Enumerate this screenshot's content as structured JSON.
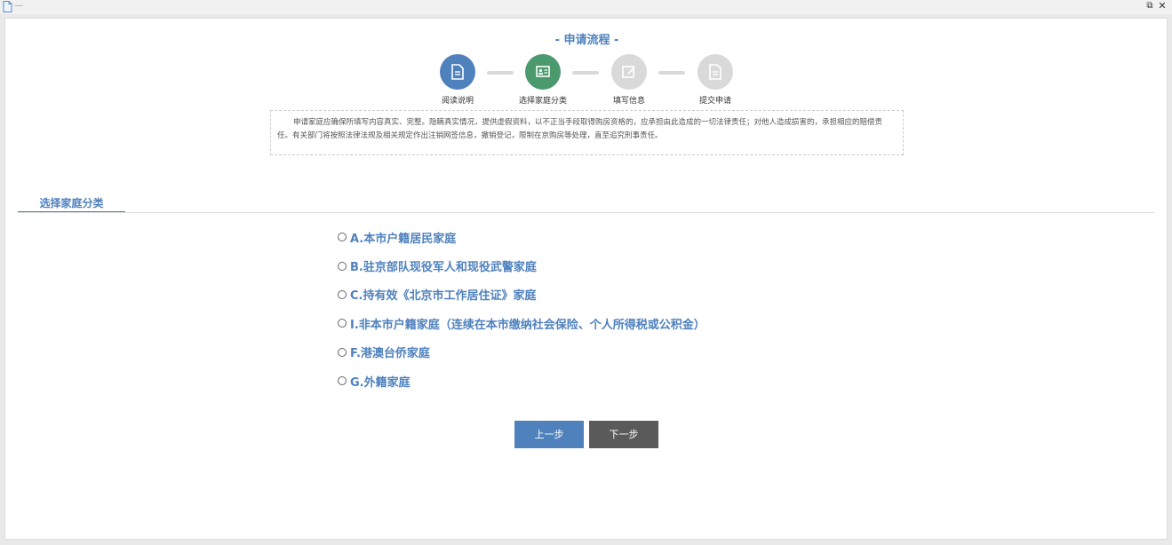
{
  "window": {
    "title": "—",
    "icons": {
      "doc": "document-icon",
      "restore": "restore-icon",
      "close": "close-icon"
    }
  },
  "flow": {
    "title": "- 申请流程 -",
    "steps": [
      {
        "label": "阅读说明",
        "icon": "document-icon",
        "color": "#4f81bd",
        "state": "done"
      },
      {
        "label": "选择家庭分类",
        "icon": "id-card-icon",
        "color": "#4b9a6e",
        "state": "current"
      },
      {
        "label": "填写信息",
        "icon": "edit-icon",
        "color": "#d9d9d9",
        "state": "pending"
      },
      {
        "label": "提交申请",
        "icon": "document-icon",
        "color": "#d9d9d9",
        "state": "pending"
      }
    ]
  },
  "notice": "申请家庭应确保所填写内容真实、完整。隐瞒真实情况，提供虚假资料，以不正当手段取得购房资格的，应承担由此造成的一切法律责任；对他人造成损害的，承担相应的赔偿责任。有关部门将按照法律法规及相关规定作出注销网签信息，撤销登记，限制在京购房等处理，直至追究刑事责任。",
  "section": {
    "title": "选择家庭分类"
  },
  "options": [
    {
      "label": "A.本市户籍居民家庭"
    },
    {
      "label": "B.驻京部队现役军人和现役武警家庭"
    },
    {
      "label": "C.持有效《北京市工作居住证》家庭"
    },
    {
      "label": "I.非本市户籍家庭（连续在本市缴纳社会保险、个人所得税或公积金）"
    },
    {
      "label": "F.港澳台侨家庭"
    },
    {
      "label": "G.外籍家庭"
    }
  ],
  "buttons": {
    "prev": "上一步",
    "next": "下一步"
  },
  "colors": {
    "accent": "#4f81bd",
    "current_step": "#4b9a6e",
    "inactive": "#d9d9d9",
    "next_button": "#5a5a5a"
  }
}
